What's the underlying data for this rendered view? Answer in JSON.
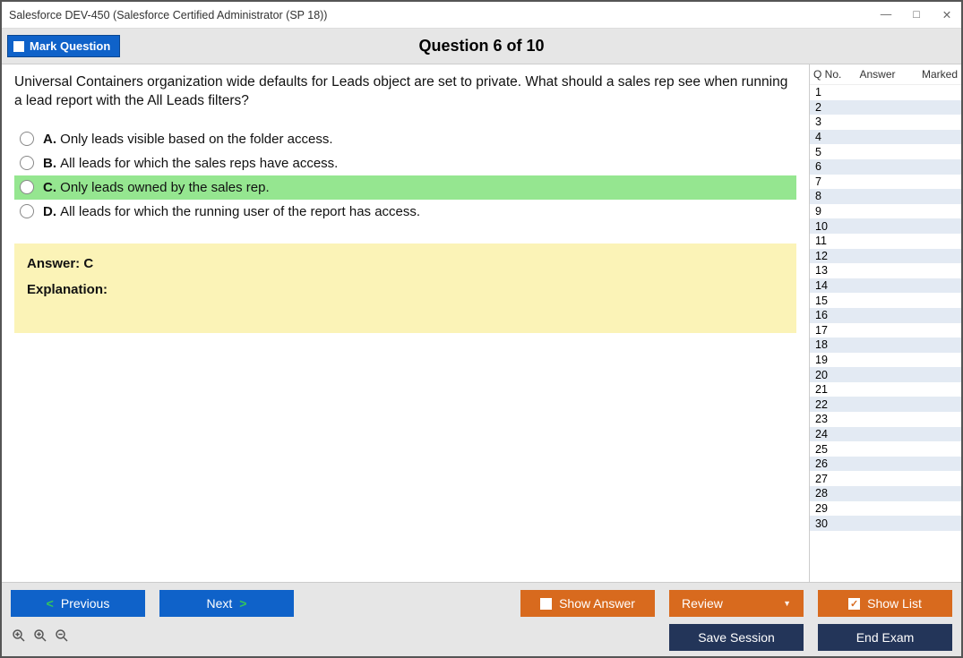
{
  "window": {
    "title": "Salesforce DEV-450 (Salesforce Certified Administrator (SP 18))"
  },
  "header": {
    "mark_label": "Mark Question",
    "question_title": "Question 6 of 10"
  },
  "question": {
    "text": "Universal Containers organization wide defaults for Leads object are set to private. What should a sales rep see when running a lead report with the All Leads filters?",
    "options": [
      {
        "letter": "A.",
        "text": "Only leads visible based on the folder access.",
        "selected": false
      },
      {
        "letter": "B.",
        "text": "All leads for which the sales reps have access.",
        "selected": false
      },
      {
        "letter": "C.",
        "text": "Only leads owned by the sales rep.",
        "selected": true
      },
      {
        "letter": "D.",
        "text": "All leads for which the running user of the report has access.",
        "selected": false
      }
    ],
    "answer_label": "Answer: C",
    "explanation_label": "Explanation:"
  },
  "sidebar": {
    "headers": {
      "qno": "Q No.",
      "answer": "Answer",
      "marked": "Marked"
    },
    "count": 30
  },
  "footer": {
    "previous": "Previous",
    "next": "Next",
    "show_answer": "Show Answer",
    "review": "Review",
    "show_list": "Show List",
    "save_session": "Save Session",
    "end_exam": "End Exam"
  }
}
